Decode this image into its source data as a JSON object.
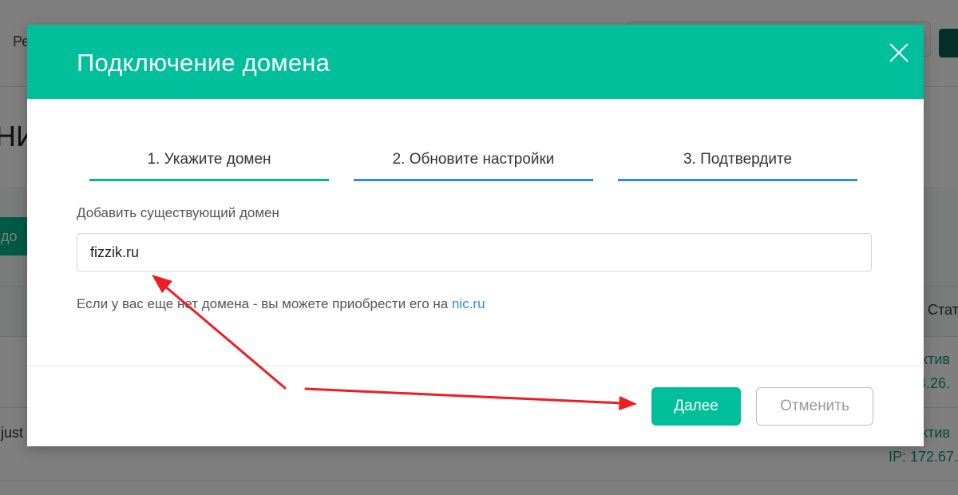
{
  "background": {
    "header_text": "Ре",
    "page_title_fragment": "НИ",
    "add_button_fragment": "е до",
    "table_status_header": "Стат",
    "row1_status": "ктив",
    "row1_ip": "4.26.",
    "row2_name_fragment": ".just",
    "row2_status": "ктив",
    "row2_ip": "IP: 172.67."
  },
  "modal": {
    "title": "Подключение домена",
    "close_icon": "close-icon",
    "steps": [
      {
        "label": "1. Укажите домен",
        "color": "#00b894"
      },
      {
        "label": "2. Обновите настройки",
        "color": "#2d8fd5"
      },
      {
        "label": "3. Подтвердите",
        "color": "#2d8fd5"
      }
    ],
    "field_label": "Добавить существующий домен",
    "domain_value": "fizzik.ru",
    "hint_text": "Если у вас еще нет домена - вы можете приобрести его на ",
    "hint_link": "nic.ru",
    "next_button": "Далее",
    "cancel_button": "Отменить"
  },
  "colors": {
    "accent": "#00bf9a",
    "link": "#2a8fd6",
    "annotation_arrow": "#ee1c24"
  }
}
